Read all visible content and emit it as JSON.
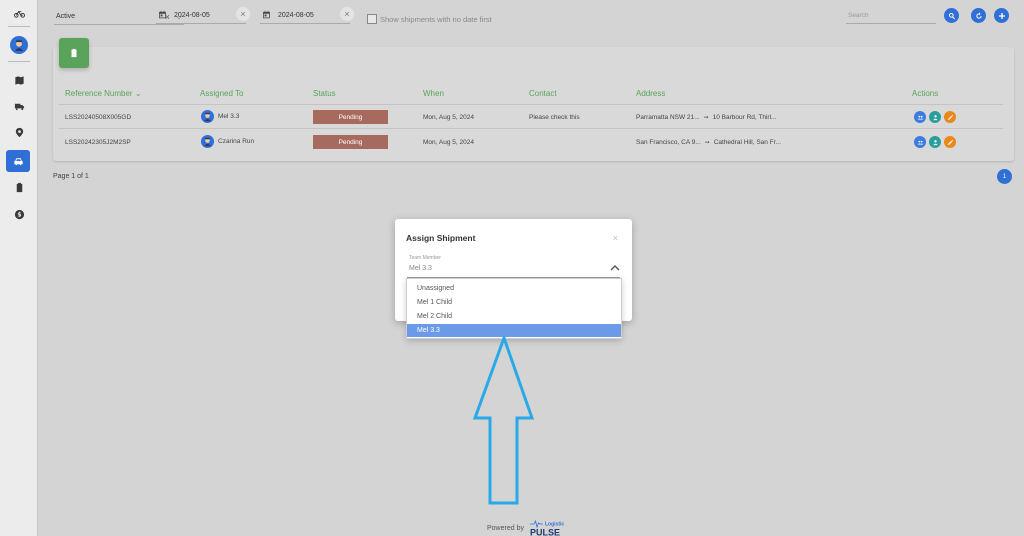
{
  "sidebar": {
    "items": [
      {
        "name": "bicycle-icon"
      },
      {
        "name": "avatar"
      },
      {
        "name": "map-icon"
      },
      {
        "name": "truck-icon"
      },
      {
        "name": "location-pin-icon"
      },
      {
        "name": "car-icon",
        "active": true
      },
      {
        "name": "clipboard-icon"
      },
      {
        "name": "dollar-icon"
      }
    ]
  },
  "filters": {
    "status_value": "Active",
    "date_from": "2024-08-05",
    "date_to": "2024-08-05",
    "show_no_date_label": "Show shipments with no date first",
    "search_placeholder": "Search"
  },
  "table": {
    "headers": {
      "reference": "Reference Number",
      "assigned": "Assigned To",
      "status": "Status",
      "when": "When",
      "contact": "Contact",
      "address": "Address",
      "actions": "Actions"
    },
    "rows": [
      {
        "reference": "LSS20240508X005GD",
        "assigned": "Mel 3.3",
        "status": "Pending",
        "when": "Mon, Aug 5, 2024",
        "contact": "Please check this",
        "address_from": "Parramatta NSW 21...",
        "address_to": "10 Barbour Rd, Thirl..."
      },
      {
        "reference": "LSS20242305J2M2SP",
        "assigned": "Czarina Run",
        "status": "Pending",
        "when": "Mon, Aug 5, 2024",
        "contact": "",
        "address_from": "San Francisco, CA 9...",
        "address_to": "Cathedral Hill, San Fr..."
      }
    ]
  },
  "pager": {
    "text": "Page 1 of 1",
    "current": "1"
  },
  "modal": {
    "title": "Assign Shipment",
    "close": "×",
    "field_label": "Team Member",
    "field_value": "Mel 3.3",
    "options": [
      "Unassigned",
      "Mel 1 Child",
      "Mel 2 Child",
      "Mel 3.3"
    ],
    "selected_index": 3
  },
  "footer": {
    "powered_by": "Powered by",
    "logo_text": "PULSE",
    "logo_small": "Logistic"
  },
  "colors": {
    "accent": "#2f6fd6",
    "header_green": "#5aa35a",
    "status_pending": "#a66a5e",
    "action_team": "#3d7be0",
    "action_view": "#2a9d9d",
    "action_edit": "#e8891a",
    "annotation_arrow": "#29a9e8"
  }
}
